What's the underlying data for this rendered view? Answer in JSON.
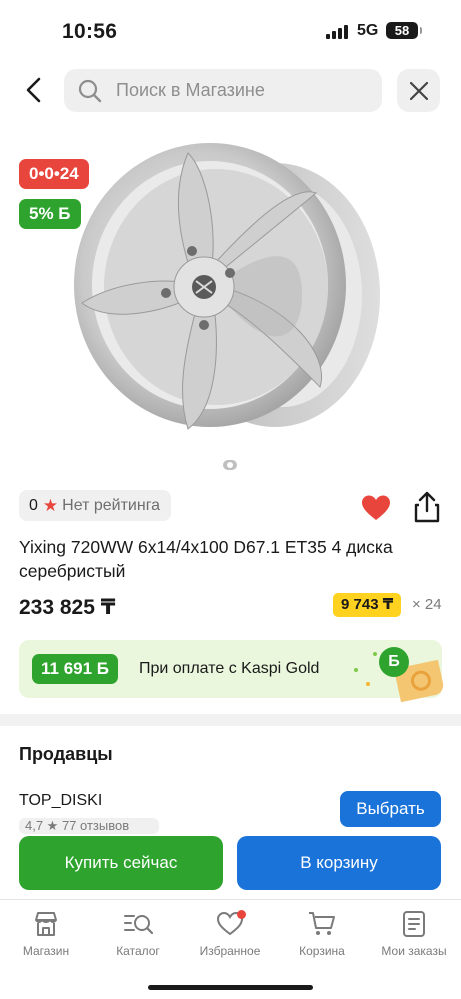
{
  "status_bar": {
    "time": "10:56",
    "network": "5G",
    "battery": "58"
  },
  "header": {
    "search_placeholder": "Поиск в Магазине"
  },
  "product": {
    "installment_badge": "0•0•24",
    "bonus_badge": "5% Б",
    "rating_count": "0",
    "rating_label": "Нет рейтинга",
    "title": "Yixing 720WW 6x14/4x100 D67.1 ET35 4 диска серебристый",
    "price": "233 825 ₸",
    "monthly_payment": "9 743 ₸",
    "months": "× 24"
  },
  "kaspi_gold": {
    "bonus_amount": "11 691 Б",
    "text": "При оплате с Kaspi Gold",
    "coin_label": "Б"
  },
  "sellers": {
    "title": "Продавцы",
    "items": [
      {
        "name": "TOP_DISKI",
        "rating": "4,7 ★ 77 отзывов",
        "button": "Выбрать"
      }
    ]
  },
  "actions": {
    "buy_now": "Купить сейчас",
    "add_to_cart": "В корзину"
  },
  "bottom_nav": [
    {
      "label": "Магазин",
      "icon": "store-icon"
    },
    {
      "label": "Каталог",
      "icon": "catalog-search-icon"
    },
    {
      "label": "Избранное",
      "icon": "heart-outline-icon"
    },
    {
      "label": "Корзина",
      "icon": "cart-icon"
    },
    {
      "label": "Мои заказы",
      "icon": "orders-icon"
    }
  ],
  "colors": {
    "kaspi_red": "#e8453c",
    "kaspi_green": "#2ea32e",
    "kaspi_blue": "#1a73d9",
    "installment_yellow": "#ffd21f"
  }
}
